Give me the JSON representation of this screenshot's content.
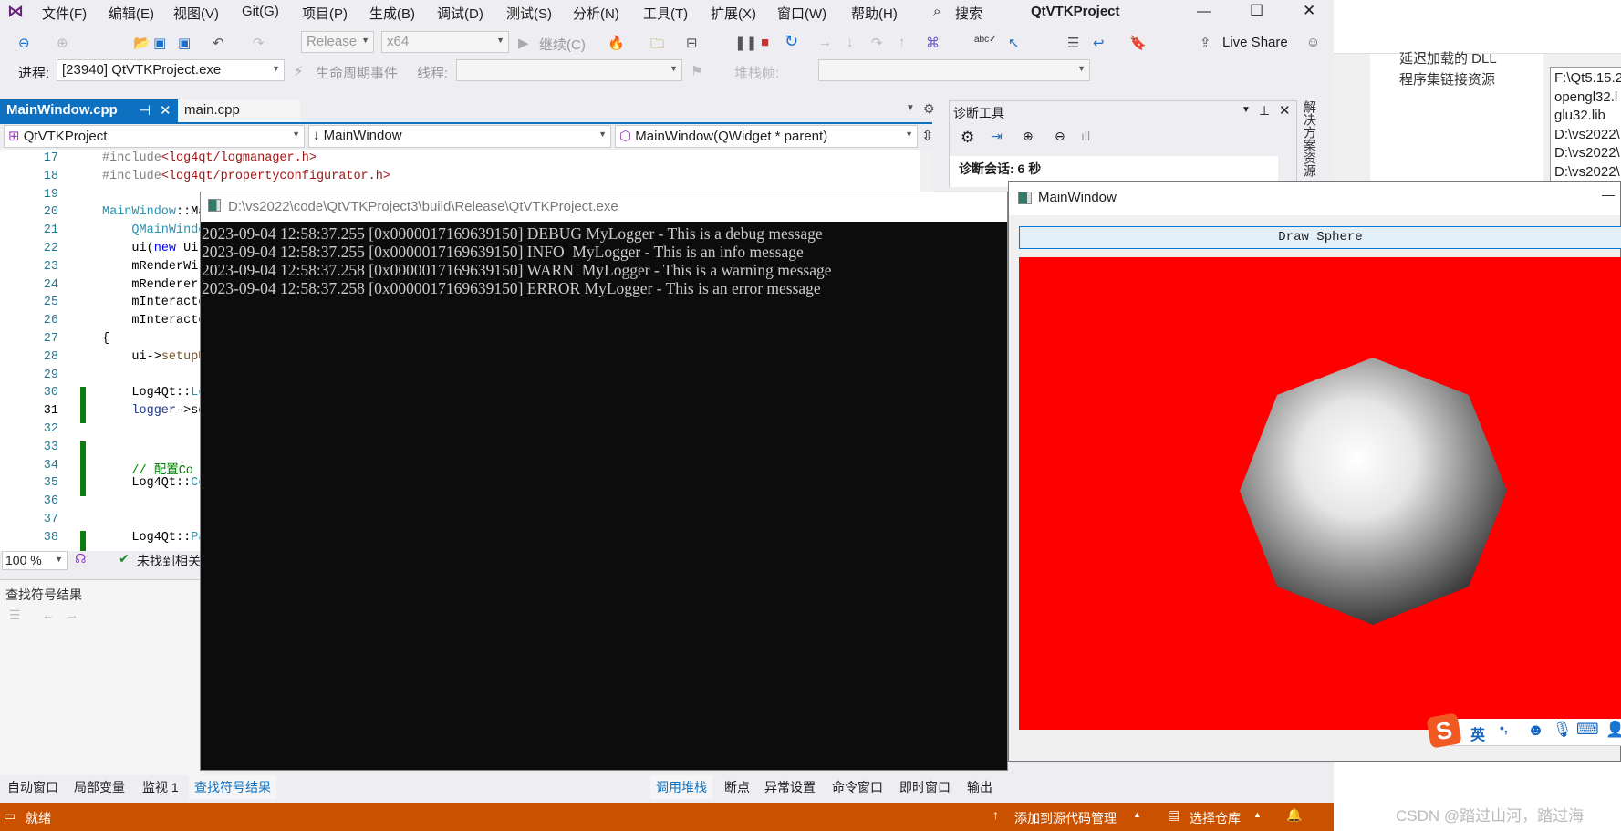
{
  "menubar": {
    "items": [
      "文件(F)",
      "编辑(E)",
      "视图(V)",
      "Git(G)",
      "项目(P)",
      "生成(B)",
      "调试(D)",
      "测试(S)",
      "分析(N)",
      "工具(T)",
      "扩展(X)",
      "窗口(W)",
      "帮助(H)"
    ],
    "search": "搜索",
    "title": "QtVTKProject"
  },
  "toolbar": {
    "config": "Release",
    "platform": "x64",
    "continue": "继续(C)",
    "live_share": "Live Share",
    "process_label": "进程:",
    "process": "[23940] QtVTKProject.exe",
    "lifecycle": "生命周期事件",
    "thread_label": "线程:",
    "stack_label": "堆栈帧:"
  },
  "tabs": [
    {
      "label": "MainWindow.cpp",
      "active": true
    },
    {
      "label": "main.cpp",
      "active": false
    }
  ],
  "nav": {
    "project": "QtVTKProject",
    "class": "MainWindow",
    "member": "MainWindow(QWidget * parent)"
  },
  "editor": {
    "lines": [
      {
        "n": "17",
        "seg": [
          {
            "t": "#include",
            "k": "pre"
          },
          {
            "t": "<log4qt/logmanager.h>",
            "k": "str"
          }
        ]
      },
      {
        "n": "18",
        "seg": [
          {
            "t": "#include",
            "k": "pre"
          },
          {
            "t": "<log4qt/propertyconfigurator.h>",
            "k": "str"
          }
        ]
      },
      {
        "n": "19",
        "seg": []
      },
      {
        "n": "20",
        "seg": [
          {
            "t": "MainWindow",
            "k": "type"
          },
          {
            "t": "::Ma",
            "k": "txt"
          }
        ]
      },
      {
        "n": "21",
        "seg": [
          {
            "t": "    QMainWindo",
            "k": "type"
          }
        ]
      },
      {
        "n": "22",
        "seg": [
          {
            "t": "    ui(",
            "k": "txt"
          },
          {
            "t": "new",
            "k": "kw"
          },
          {
            "t": " Ui",
            "k": "txt"
          }
        ]
      },
      {
        "n": "23",
        "seg": [
          {
            "t": "    mRenderWi",
            "k": "txt"
          }
        ]
      },
      {
        "n": "24",
        "seg": [
          {
            "t": "    mRenderer",
            "k": "txt"
          }
        ]
      },
      {
        "n": "25",
        "seg": [
          {
            "t": "    mInteracto",
            "k": "txt"
          }
        ]
      },
      {
        "n": "26",
        "seg": [
          {
            "t": "    mInteracto",
            "k": "txt"
          }
        ]
      },
      {
        "n": "27",
        "seg": [
          {
            "t": "{",
            "k": "txt"
          }
        ]
      },
      {
        "n": "28",
        "seg": [
          {
            "t": "    ui->",
            "k": "txt"
          },
          {
            "t": "setupU",
            "k": "fn"
          }
        ]
      },
      {
        "n": "29",
        "seg": []
      },
      {
        "n": "30",
        "seg": [
          {
            "t": "    Log4Qt::",
            "k": "txt"
          },
          {
            "t": "Lo",
            "k": "type"
          }
        ]
      },
      {
        "n": "31",
        "seg": [
          {
            "t": "    logger",
            "k": "var"
          },
          {
            "t": "->se",
            "k": "txt"
          }
        ]
      },
      {
        "n": "32",
        "seg": []
      },
      {
        "n": "33",
        "seg": []
      },
      {
        "n": "34",
        "seg": [
          {
            "t": "    // 配置Co",
            "k": "cm"
          }
        ]
      },
      {
        "n": "35",
        "seg": [
          {
            "t": "    Log4Qt::",
            "k": "txt"
          },
          {
            "t": "Co",
            "k": "type"
          }
        ]
      },
      {
        "n": "36",
        "seg": []
      },
      {
        "n": "37",
        "seg": []
      },
      {
        "n": "38",
        "seg": [
          {
            "t": "    Log4Qt::",
            "k": "txt"
          },
          {
            "t": "Pa",
            "k": "type"
          }
        ]
      }
    ],
    "zoom": "100 %",
    "issues": "未找到相关"
  },
  "find_panel": {
    "title": "查找符号结果"
  },
  "diag": {
    "title": "诊断工具",
    "session": "诊断会话: 6 秒"
  },
  "side_tab": "解决方案资源",
  "bottom_tabs_left": [
    "自动窗口",
    "局部变量",
    "监视 1",
    "查找符号结果"
  ],
  "bottom_tabs_right": [
    "调用堆栈",
    "断点",
    "异常设置",
    "命令窗口",
    "即时窗口",
    "输出"
  ],
  "status": {
    "ready": "就绪",
    "source_control": "添加到源代码管理",
    "repo": "选择仓库"
  },
  "console": {
    "title": "D:\\vs2022\\code\\QtVTKProject3\\build\\Release\\QtVTKProject.exe",
    "lines": [
      "2023-09-04 12:58:37.255 [0x0000017169639150] DEBUG MyLogger - This is a debug message",
      "2023-09-04 12:58:37.255 [0x0000017169639150] INFO  MyLogger - This is an info message",
      "2023-09-04 12:58:37.258 [0x0000017169639150] WARN  MyLogger - This is a warning message",
      "2023-09-04 12:58:37.258 [0x0000017169639150] ERROR MyLogger - This is an error message"
    ]
  },
  "qt_window": {
    "title": "MainWindow",
    "button": "Draw Sphere",
    "background": "#ff0000"
  },
  "ime": {
    "lang": "英",
    "punct": "•,"
  },
  "background_window": {
    "list": [
      "延迟加载的 DLL",
      "程序集链接资源"
    ],
    "values": [
      "F:\\Qt5.15.2",
      "opengl32.l",
      "glu32.lib",
      "D:\\vs2022\\",
      "D:\\vs2022\\",
      "D:\\vs2022\\"
    ]
  },
  "watermark": "CSDN @踏过山河，踏过海",
  "colors": {
    "accent": "#007acc",
    "status_bar": "#ca5100",
    "change_bar": "#107c10"
  }
}
